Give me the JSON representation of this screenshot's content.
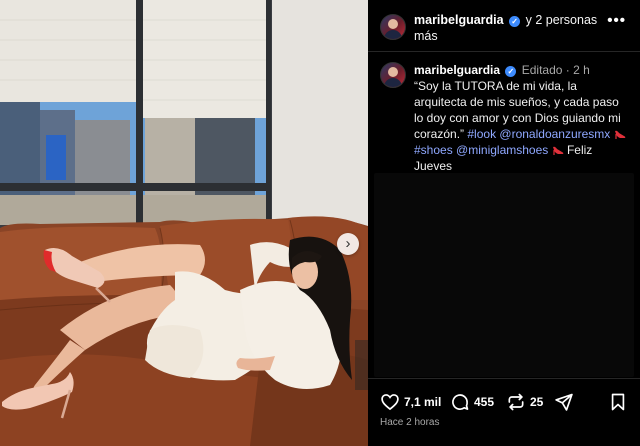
{
  "header": {
    "username": "maribelguardia",
    "suffix": "y 2 personas más",
    "more_label": "•••"
  },
  "caption": {
    "username": "maribelguardia",
    "edited_label": "Editado",
    "time": "2 h",
    "text": "“Soy la TUTORA  de mi vida, la arquitecta de mis sueños, y cada paso lo doy con amor y con Dios guiando mi corazón.”",
    "tags": [
      "#look",
      "@ronaldoanzuresmx",
      "#shoes",
      "@miniglamshoes"
    ],
    "closing": "Feliz Jueves",
    "heart": "♥"
  },
  "actions": {
    "likes": "7,1 mil",
    "comments": "455",
    "reposts": "25"
  },
  "timestamp": "Hace 2 horas",
  "photo": {
    "next_label": "›"
  },
  "colors": {
    "background": "#000000",
    "link": "#8fa8ff",
    "verified": "#3d8bfd",
    "muted": "#a8a8a8"
  },
  "icons": [
    "verified-icon",
    "more-icon",
    "heart-icon",
    "comment-icon",
    "repost-icon",
    "share-icon",
    "bookmark-icon",
    "high-heel-icon",
    "next-arrow-icon"
  ]
}
